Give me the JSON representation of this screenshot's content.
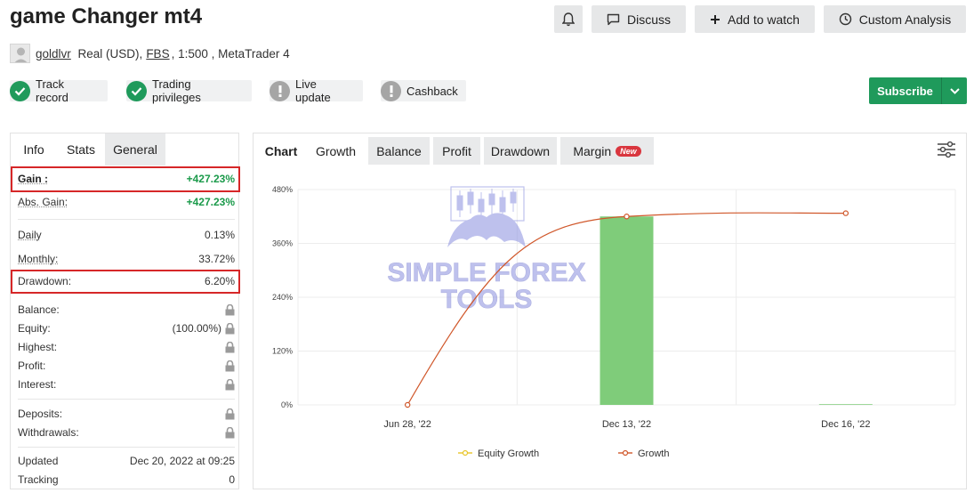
{
  "title": "game Changer mt4",
  "top_buttons": {
    "discuss": "Discuss",
    "watch": "Add to watch",
    "analysis": "Custom Analysis"
  },
  "account": {
    "user": "goldlvr",
    "type": "Real (USD),",
    "broker": "FBS",
    "leverage": ", 1:500 , MetaTrader 4"
  },
  "badges": {
    "track": "Track record",
    "trading": "Trading privileges",
    "live": "Live update",
    "cashback": "Cashback"
  },
  "subscribe_label": "Subscribe",
  "left_tabs": {
    "info": "Info",
    "stats": "Stats",
    "general": "General"
  },
  "stats": {
    "gain_label": "Gain :",
    "gain_value": "+427.23%",
    "abs_gain_label": "Abs. Gain:",
    "abs_gain_value": "+427.23%",
    "daily_label": "Daily",
    "daily_value": "0.13%",
    "monthly_label": "Monthly:",
    "monthly_value": "33.72%",
    "drawdown_label": "Drawdown:",
    "drawdown_value": "6.20%",
    "balance_label": "Balance:",
    "equity_label": "Equity:",
    "equity_value": "(100.00%)",
    "highest_label": "Highest:",
    "profit_label": "Profit:",
    "interest_label": "Interest:",
    "deposits_label": "Deposits:",
    "withdrawals_label": "Withdrawals:",
    "updated_label": "Updated",
    "updated_value": "Dec 20, 2022 at 09:25",
    "tracking_label": "Tracking",
    "tracking_value": "0"
  },
  "chart_tabs": {
    "chart": "Chart",
    "growth": "Growth",
    "balance": "Balance",
    "profit": "Profit",
    "drawdown": "Drawdown",
    "margin": "Margin",
    "new_badge": "New"
  },
  "watermark": {
    "line1": "SIMPLE FOREX",
    "line2": "TOOLS"
  },
  "colors": {
    "accent_green": "#1f9a5b",
    "gain_green": "#1a9a4a",
    "highlight_red": "#d62728",
    "bar_green": "#7fcc7a",
    "growth_line": "#d0572a",
    "equity_line": "#e8c52a"
  },
  "chart_data": {
    "type": "bar",
    "categories": [
      "Jun 28, '22",
      "Dec 13, '22",
      "Dec 16, '22"
    ],
    "ylim": [
      0,
      480
    ],
    "yticks": [
      "0%",
      "120%",
      "240%",
      "360%",
      "480%"
    ],
    "bars": [
      0,
      420,
      1.5
    ],
    "series": [
      {
        "name": "Equity Growth",
        "values": []
      },
      {
        "name": "Growth",
        "values": [
          0,
          420,
          427.23
        ]
      }
    ],
    "legend_position": "bottom",
    "grid": true
  }
}
